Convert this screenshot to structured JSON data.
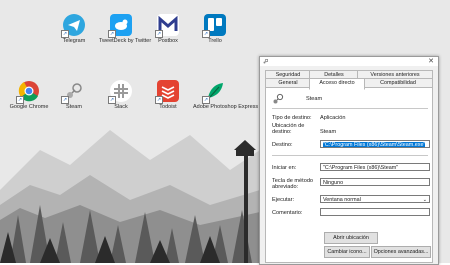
{
  "desktop": {
    "icons": [
      {
        "label": "Telegram",
        "color": "#2ea6df",
        "glyph": "✈"
      },
      {
        "label": "TweetDeck by Twitter",
        "color": "#1da1f2",
        "glyph": "🐦"
      },
      {
        "label": "Postbox",
        "color": "#ffffff",
        "glyph": "M"
      },
      {
        "label": "Trello",
        "color": "#0079bf",
        "glyph": "▮▮"
      },
      {
        "label": "Google Chrome",
        "color": "#ffffff",
        "glyph": "●"
      },
      {
        "label": "Steam",
        "color": "#e6e6e6",
        "glyph": "⚙"
      },
      {
        "label": "Slack",
        "color": "#ffffff",
        "glyph": "#"
      },
      {
        "label": "Todoist",
        "color": "#e44332",
        "glyph": "≡"
      },
      {
        "label": "Adobe Photoshop Express",
        "color": "#31a8ff",
        "glyph": "✒"
      }
    ]
  },
  "dialog": {
    "tabs_row1": [
      "Seguridad",
      "Detalles",
      "Versiones anteriores"
    ],
    "tabs_row2": [
      "General",
      "Acceso directo",
      "Compatibilidad"
    ],
    "active_tab": "Acceso directo",
    "app_name": "Steam",
    "fields": {
      "tipo_label": "Tipo de destino:",
      "tipo_value": "Aplicación",
      "ubicacion_label": "Ubicación de destino:",
      "ubicacion_value": "Steam",
      "destino_label": "Destino:",
      "destino_value": "\"C:\\Program Files (x86)\\Steam\\Steam.exe\"",
      "iniciar_label": "Iniciar en:",
      "iniciar_value": "\"C:\\Program Files (x86)\\Steam\"",
      "tecla_label": "Tecla de método abreviado:",
      "tecla_value": "Ninguno",
      "ejecutar_label": "Ejecutar:",
      "ejecutar_value": "Ventana normal",
      "comentario_label": "Comentario:",
      "comentario_value": ""
    },
    "buttons": {
      "abrir_ubicacion": "Abrir ubicación",
      "cambiar_icono": "Cambiar icono...",
      "opciones_avanzadas": "Opciones avanzadas..."
    },
    "close_glyph": "✕"
  }
}
